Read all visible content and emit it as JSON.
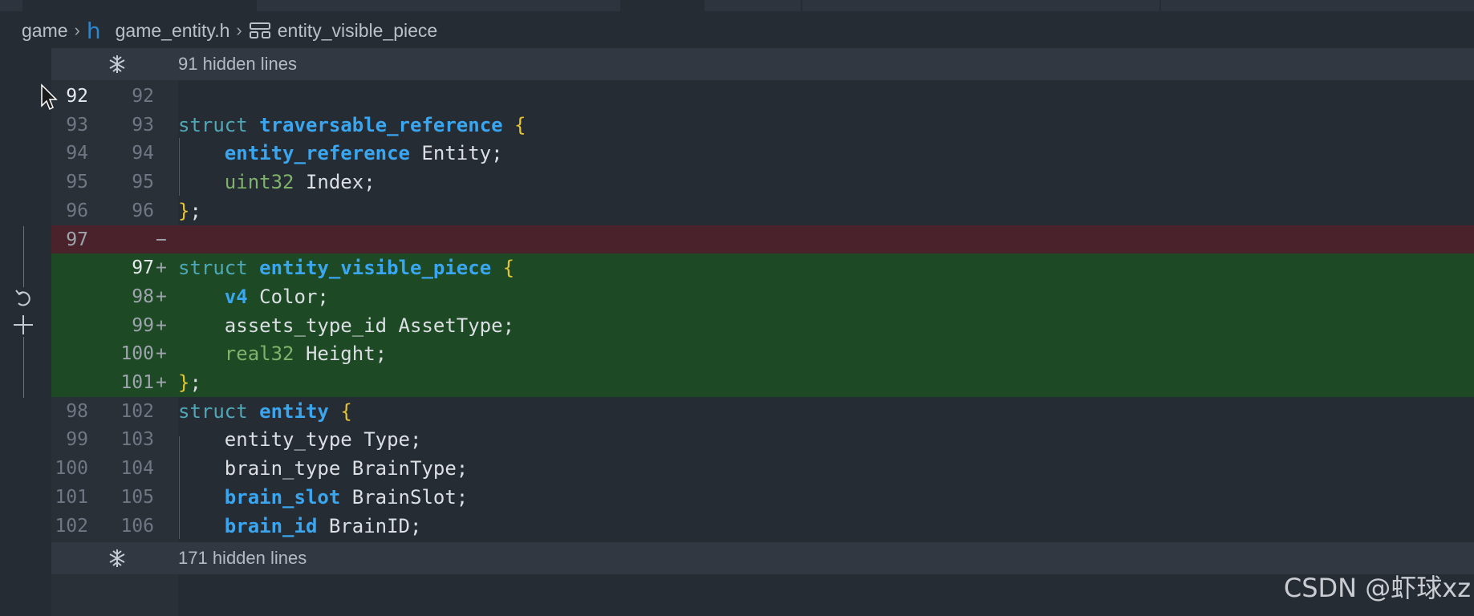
{
  "breadcrumb": {
    "folder": "game",
    "file_icon": "h",
    "file": "game_entity.h",
    "symbol": "entity_visible_piece"
  },
  "hidden_top": {
    "label": "91 hidden lines",
    "icon": "expand-icon"
  },
  "hidden_bottom": {
    "label": "171 hidden lines",
    "icon": "expand-icon"
  },
  "colors": {
    "removed_bg": "#4a222c",
    "added_bg": "#1d4a25",
    "keyword": "#4ea8b8",
    "type": "#3aa6f0",
    "basic_type": "#7fb36b",
    "brace": "#e6c431"
  },
  "lines": [
    {
      "old": "92",
      "new": "92",
      "mark": "",
      "kind": "normal",
      "tokens": []
    },
    {
      "old": "93",
      "new": "93",
      "mark": "",
      "kind": "normal",
      "tokens": [
        [
          "kw",
          "struct "
        ],
        [
          "type",
          "traversable_reference"
        ],
        [
          "plain",
          " "
        ],
        [
          "brace",
          "{"
        ]
      ]
    },
    {
      "old": "94",
      "new": "94",
      "mark": "",
      "kind": "normal",
      "tokens": [
        [
          "plain",
          "    "
        ],
        [
          "type",
          "entity_reference"
        ],
        [
          "plain",
          " Entity;"
        ]
      ]
    },
    {
      "old": "95",
      "new": "95",
      "mark": "",
      "kind": "normal",
      "tokens": [
        [
          "plain",
          "    "
        ],
        [
          "basic",
          "uint32"
        ],
        [
          "plain",
          " Index;"
        ]
      ]
    },
    {
      "old": "96",
      "new": "96",
      "mark": "",
      "kind": "normal",
      "tokens": [
        [
          "brace",
          "}"
        ],
        [
          "plain",
          ";"
        ]
      ]
    },
    {
      "old": "97",
      "new": "",
      "mark": "−",
      "kind": "removed",
      "tokens": []
    },
    {
      "old": "",
      "new": "97",
      "mark": "+",
      "kind": "added",
      "tokens": [
        [
          "kw",
          "struct "
        ],
        [
          "type",
          "entity_visible_piece"
        ],
        [
          "plain",
          " "
        ],
        [
          "brace",
          "{"
        ]
      ]
    },
    {
      "old": "",
      "new": "98",
      "mark": "+",
      "kind": "added",
      "tokens": [
        [
          "plain",
          "    "
        ],
        [
          "type",
          "v4"
        ],
        [
          "plain",
          " Color;"
        ]
      ]
    },
    {
      "old": "",
      "new": "99",
      "mark": "+",
      "kind": "added",
      "tokens": [
        [
          "plain",
          "    assets_type_id AssetType;"
        ]
      ]
    },
    {
      "old": "",
      "new": "100",
      "mark": "+",
      "kind": "added",
      "tokens": [
        [
          "plain",
          "    "
        ],
        [
          "basic",
          "real32"
        ],
        [
          "plain",
          " Height;"
        ]
      ]
    },
    {
      "old": "",
      "new": "101",
      "mark": "+",
      "kind": "added",
      "tokens": [
        [
          "brace",
          "}"
        ],
        [
          "plain",
          ";"
        ]
      ]
    },
    {
      "old": "98",
      "new": "102",
      "mark": "",
      "kind": "normal",
      "tokens": [
        [
          "kw",
          "struct "
        ],
        [
          "type",
          "entity"
        ],
        [
          "plain",
          " "
        ],
        [
          "brace",
          "{"
        ]
      ]
    },
    {
      "old": "99",
      "new": "103",
      "mark": "",
      "kind": "normal",
      "tokens": [
        [
          "plain",
          "    entity_type Type;"
        ]
      ]
    },
    {
      "old": "100",
      "new": "104",
      "mark": "",
      "kind": "normal",
      "tokens": [
        [
          "plain",
          "    brain_type BrainType;"
        ]
      ]
    },
    {
      "old": "101",
      "new": "105",
      "mark": "",
      "kind": "normal",
      "tokens": [
        [
          "plain",
          "    "
        ],
        [
          "type",
          "brain_slot"
        ],
        [
          "plain",
          " BrainSlot;"
        ]
      ]
    },
    {
      "old": "102",
      "new": "106",
      "mark": "",
      "kind": "normal",
      "tokens": [
        [
          "plain",
          "    "
        ],
        [
          "type",
          "brain_id"
        ],
        [
          "plain",
          " BrainID;"
        ]
      ]
    }
  ],
  "margin_controls": {
    "revert_icon": "revert-icon",
    "stage_icon": "plus-icon"
  },
  "watermark": "CSDN @虾球xz"
}
